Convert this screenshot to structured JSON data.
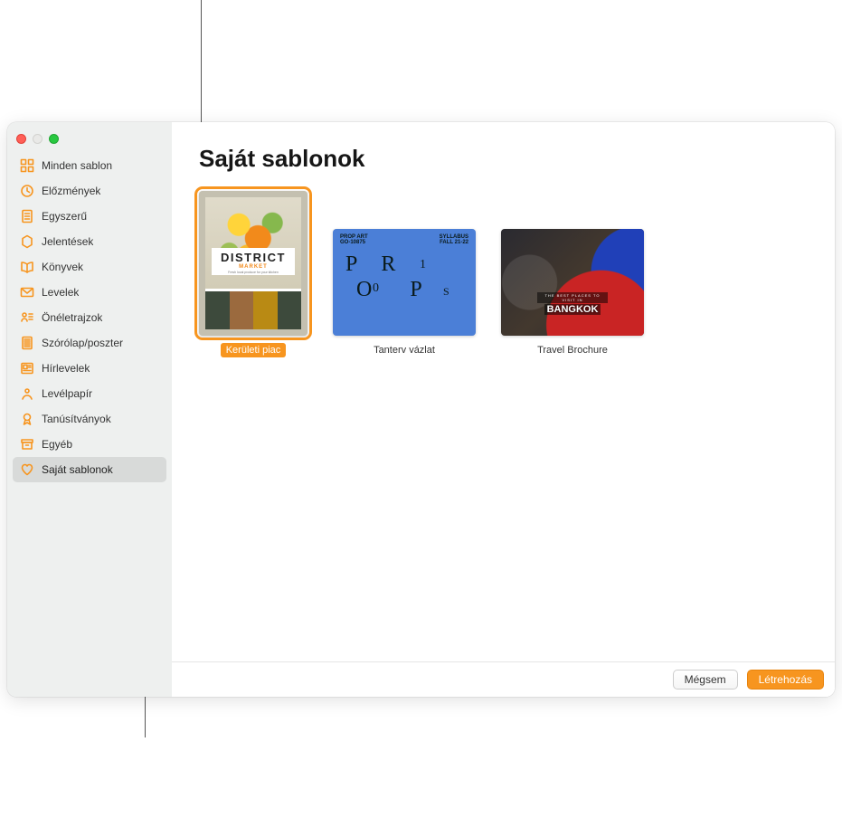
{
  "window": {
    "title": "Saját sablonok"
  },
  "sidebar": {
    "items": [
      {
        "label": "Minden sablon",
        "icon": "grid"
      },
      {
        "label": "Előzmények",
        "icon": "clock"
      },
      {
        "label": "Egyszerű",
        "icon": "doc-lines"
      },
      {
        "label": "Jelentések",
        "icon": "hex-star"
      },
      {
        "label": "Könyvek",
        "icon": "book"
      },
      {
        "label": "Levelek",
        "icon": "envelope"
      },
      {
        "label": "Önéletrajzok",
        "icon": "person-list"
      },
      {
        "label": "Szórólap/poszter",
        "icon": "doc-dense"
      },
      {
        "label": "Hírlevelek",
        "icon": "newspaper"
      },
      {
        "label": "Levélpapír",
        "icon": "letterhead"
      },
      {
        "label": "Tanúsítványok",
        "icon": "ribbon"
      },
      {
        "label": "Egyéb",
        "icon": "archive-box"
      },
      {
        "label": "Saját sablonok",
        "icon": "heart",
        "selected": true
      }
    ]
  },
  "templates": [
    {
      "name": "Kerületi piac",
      "selected": true,
      "orientation": "portrait",
      "art": {
        "title": "DISTRICT",
        "subtitle": "MARKET",
        "tagline": "Fresh local produce for your kitchen"
      }
    },
    {
      "name": "Tanterv vázlat",
      "selected": false,
      "orientation": "landscape",
      "art": {
        "top_left_line1": "PROP ART",
        "top_left_line2": "GO-10875",
        "top_right_line1": "SYLLABUS",
        "top_right_line2": "FALL 21-22",
        "letters": "PROPS",
        "num1": "1",
        "num0": "0"
      }
    },
    {
      "name": "Travel Brochure",
      "selected": false,
      "orientation": "landscape",
      "art": {
        "small": "THE BEST PLACES TO VISIT IN",
        "big": "BANGKOK"
      }
    }
  ],
  "footer": {
    "cancel": "Mégsem",
    "create": "Létrehozás"
  },
  "colors": {
    "accent": "#f7951f"
  }
}
